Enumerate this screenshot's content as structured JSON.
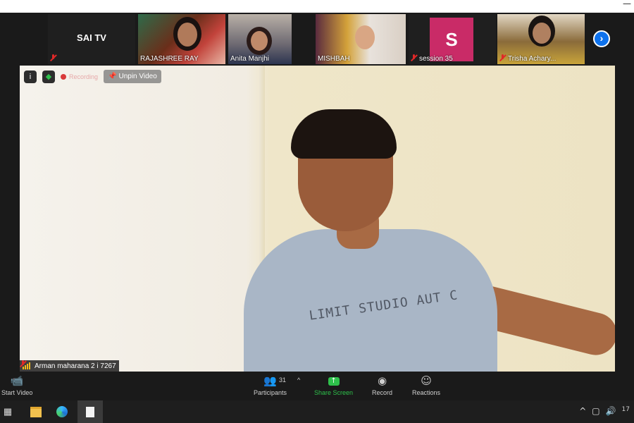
{
  "participants_strip": [
    {
      "name": "SAI TV",
      "label": "SAI TV",
      "muted": true
    },
    {
      "name": "RAJASHREE RAY",
      "muted": false
    },
    {
      "name": "Anita Manjhi",
      "muted": false
    },
    {
      "name": "MISHBAH",
      "muted": false
    },
    {
      "name": "session 35",
      "avatar_letter": "S",
      "muted": true
    },
    {
      "name": "Trisha Achary...",
      "muted": true
    }
  ],
  "main_video": {
    "recording_label": "Recording",
    "unpin_label": "Unpin Video",
    "speaker_name": "Arman maharana 2 i 7267",
    "shirt_text": "LIMIT STUDIO AUT C"
  },
  "toolbar": {
    "start_video": "Start Video",
    "participants": "Participants",
    "participants_count": "31",
    "share_screen": "Share Screen",
    "record": "Record",
    "reactions": "Reactions"
  },
  "taskbar": {
    "clock_partial": "17"
  },
  "colors": {
    "share_green": "#2ec04b",
    "zoom_blue": "#0e72ed",
    "session_avatar": "#c92b67",
    "mute_red": "#e02828"
  }
}
